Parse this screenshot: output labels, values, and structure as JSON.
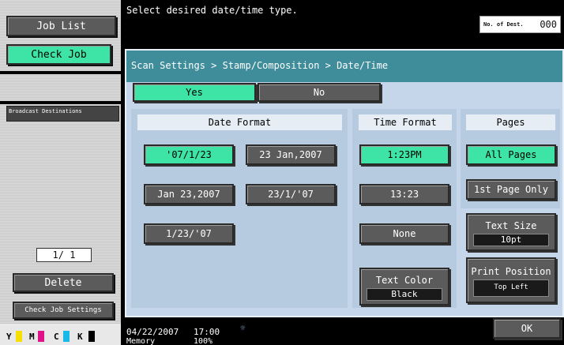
{
  "left": {
    "job_list": "Job List",
    "check_job": "Check Job",
    "broadcast": "Broadcast Destinations",
    "page_counter": "1/  1",
    "delete": "Delete",
    "check_job_settings": "Check Job Settings",
    "toner": [
      {
        "label": "Y",
        "color": "#f5e000"
      },
      {
        "label": "M",
        "color": "#e0128a"
      },
      {
        "label": "C",
        "color": "#18b8e8"
      },
      {
        "label": "K",
        "color": "#000000"
      }
    ]
  },
  "header": {
    "message": "Select desired date/time type.",
    "dest_label": "No. of Dest.",
    "dest_count": "000"
  },
  "breadcrumb": "Scan Settings > Stamp/Composition > Date/Time",
  "toggle": {
    "yes": "Yes",
    "no": "No",
    "selected": "Yes"
  },
  "date_format": {
    "title": "Date Format",
    "options": [
      "'07/1/23",
      "23 Jan,2007",
      "Jan 23,2007",
      "23/1/'07",
      "1/23/'07"
    ],
    "selected": "'07/1/23"
  },
  "time_format": {
    "title": "Time Format",
    "options": [
      "1:23PM",
      "13:23",
      "None"
    ],
    "selected": "1:23PM"
  },
  "pages": {
    "title": "Pages",
    "options": [
      "All Pages",
      "1st Page Only"
    ],
    "selected": "All Pages"
  },
  "text_size": {
    "label": "Text Size",
    "value": "10pt"
  },
  "print_position": {
    "label": "Print Position",
    "value": "Top Left"
  },
  "text_color": {
    "label": "Text Color",
    "value": "Black"
  },
  "ok": "OK",
  "status": {
    "date": "04/22/2007",
    "time": "17:00",
    "memory_label": "Memory",
    "memory_value": "100%"
  },
  "colors": {
    "accent": "#3ee3a6",
    "button": "#5b5b5b",
    "panel": "#c5d6ea",
    "breadcrumb": "#3f8d9b"
  }
}
